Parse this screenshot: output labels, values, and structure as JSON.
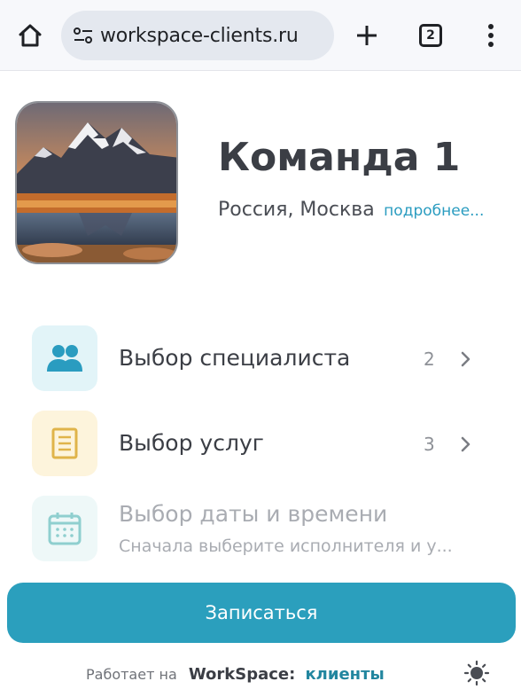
{
  "browser": {
    "url": "workspace-clients.ru",
    "tab_count": "2"
  },
  "profile": {
    "title": "Команда 1",
    "location": "Россия, Москва",
    "more_link": "подробнее..."
  },
  "menu": [
    {
      "label": "Выбор специалиста",
      "count": "2",
      "icon": "people-icon",
      "color": "#2a9cc0",
      "bg": "#e2f4f8"
    },
    {
      "label": "Выбор услуг",
      "count": "3",
      "icon": "document-list-icon",
      "color": "#e0b44a",
      "bg": "#fdf4dc"
    },
    {
      "label": "Выбор даты и времени",
      "subtitle": "Сначала выберите исполнителя и у...",
      "icon": "calendar-icon",
      "color": "#8fcfcf",
      "bg": "#eef8f8",
      "disabled": true
    }
  ],
  "cta": {
    "label": "Записаться",
    "color": "#2b9fbd"
  },
  "footer": {
    "powered_by": "Работает на",
    "brand": "WorkSpace:",
    "brand_suffix": "клиенты"
  }
}
